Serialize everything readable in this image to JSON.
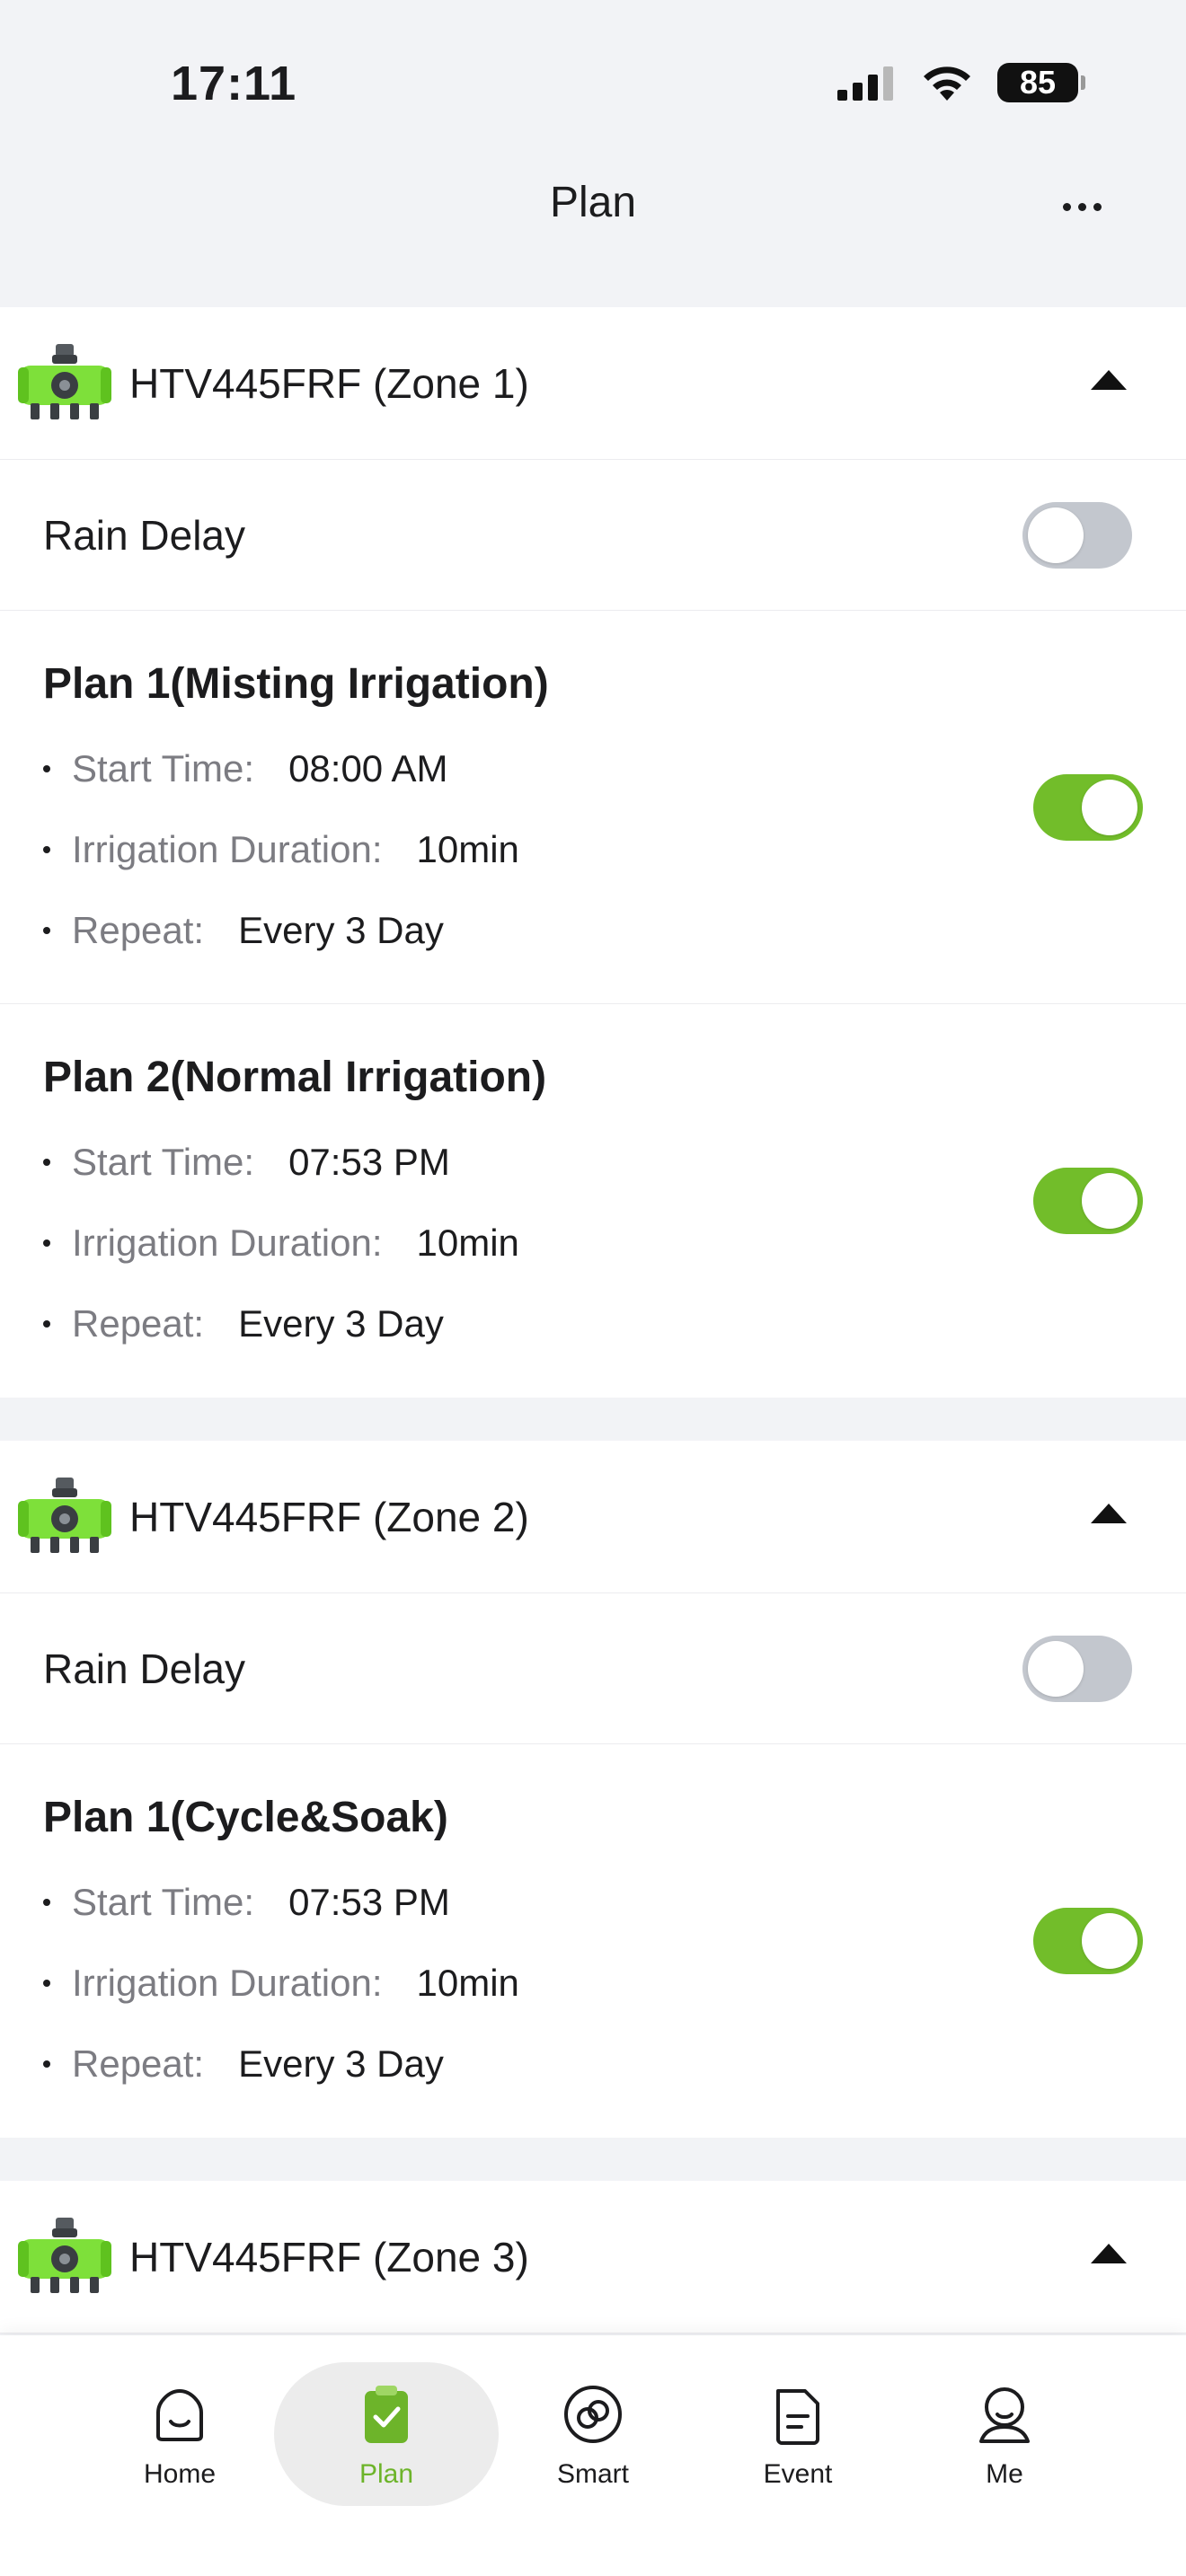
{
  "status_bar": {
    "time": "17:11",
    "battery": "85"
  },
  "nav": {
    "title": "Plan"
  },
  "zones": [
    {
      "name": "HTV445FRF (Zone 1)",
      "rain_delay_label": "Rain Delay",
      "rain_delay_on": false,
      "plans": [
        {
          "title": "Plan 1(Misting Irrigation)",
          "start_key": "Start Time:",
          "start_val": "08:00 AM",
          "dur_key": "Irrigation Duration:",
          "dur_val": "10min",
          "rep_key": "Repeat:",
          "rep_val": "Every 3 Day",
          "enabled": true
        },
        {
          "title": "Plan 2(Normal Irrigation)",
          "start_key": "Start Time:",
          "start_val": "07:53 PM",
          "dur_key": "Irrigation Duration:",
          "dur_val": "10min",
          "rep_key": "Repeat:",
          "rep_val": "Every 3 Day",
          "enabled": true
        }
      ]
    },
    {
      "name": "HTV445FRF (Zone 2)",
      "rain_delay_label": "Rain Delay",
      "rain_delay_on": false,
      "plans": [
        {
          "title": "Plan 1(Cycle&Soak)",
          "start_key": "Start Time:",
          "start_val": "07:53 PM",
          "dur_key": "Irrigation Duration:",
          "dur_val": "10min",
          "rep_key": "Repeat:",
          "rep_val": "Every 3 Day",
          "enabled": true
        }
      ]
    },
    {
      "name": "HTV445FRF (Zone 3)"
    }
  ],
  "tabs": [
    {
      "label": "Home",
      "icon": "home-icon"
    },
    {
      "label": "Plan",
      "icon": "plan-icon",
      "active": true
    },
    {
      "label": "Smart",
      "icon": "smart-icon"
    },
    {
      "label": "Event",
      "icon": "event-icon"
    },
    {
      "label": "Me",
      "icon": "me-icon"
    }
  ],
  "colors": {
    "accent": "#72bd2a",
    "toggle_off": "#c3c7ce",
    "device_green": "#7ee03a"
  }
}
